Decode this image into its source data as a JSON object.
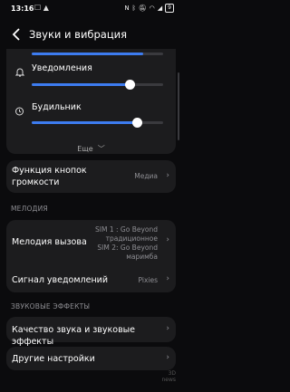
{
  "status": {
    "time": "13:16",
    "battery": "9"
  },
  "header": {
    "title": "Звуки и вибрация"
  },
  "volume": {
    "notifications_label": "Уведомления",
    "notifications_level": 0.75,
    "alarm_label": "Будильник",
    "alarm_level": 0.8,
    "top_level": 0.85,
    "more_label": "Еще"
  },
  "volume_keys": {
    "title_line1": "Функция кнопок",
    "title_line2": "громкости",
    "value": "Медиа"
  },
  "melody": {
    "section_label": "МЕЛОДИЯ",
    "ringtone_title": "Мелодия вызова",
    "ringtone_values": [
      "SIM 1 : Go Beyond",
      "традиционное",
      "SIM 2: Go Beyond",
      "маримба"
    ],
    "notif_signal_title": "Сигнал уведомлений",
    "notif_signal_value": "Pixies"
  },
  "effects": {
    "section_label": "ЗВУКОВЫЕ ЭФФЕКТЫ",
    "quality_title": "Качество звука и звуковые эффекты",
    "other_title": "Другие настройки"
  },
  "watermark": {
    "line1": "3D",
    "line2": "news"
  },
  "colors": {
    "accent": "#3d7cf0",
    "background": "#0b0b0d",
    "card": "#1c1c1e"
  }
}
